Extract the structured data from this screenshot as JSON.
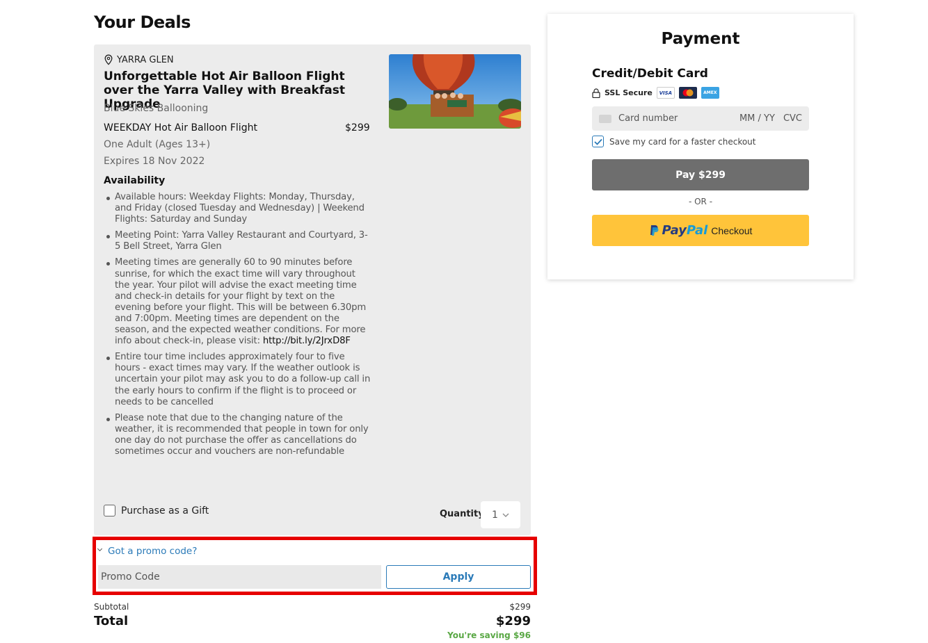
{
  "page": {
    "heading": "Your Deals"
  },
  "deal": {
    "location": "YARRA GLEN",
    "title": "Unforgettable Hot Air Balloon Flight over the Yarra Valley with Breakfast Upgrade",
    "operator": "Blue Skies Ballooning",
    "option_name": "WEEKDAY Hot Air Balloon Flight",
    "option_price": "$299",
    "pax": "One Adult (Ages 13+)",
    "expires": "Expires 18 Nov 2022",
    "availability_title": "Availability",
    "availability": [
      "Available hours: Weekday Flights: Monday, Thursday, and Friday (closed Tuesday and Wednesday) | Weekend Flights: Saturday and Sunday",
      "Meeting Point: Yarra Valley Restaurant and Courtyard, 3-5 Bell Street, Yarra Glen",
      "Meeting times are generally 60 to 90 minutes before sunrise, for which the exact time will vary throughout the year. Your pilot will advise the exact meeting time and check-in details for your flight by text on the evening before your flight. This will be between 6.30pm and 7:00pm. Meeting times are dependent on the season, and the expected weather conditions. For more info about check-in, please visit:",
      "Entire tour time includes approximately four to five hours - exact times may vary. If the weather outlook is uncertain your pilot may ask you to do a follow-up call in the early hours to confirm if the flight is to proceed or needs to be cancelled",
      "Please note that due to the changing nature of the weather, it is recommended that people in town for only one day do not purchase the offer as cancellations do sometimes occur and vouchers are non-refundable"
    ],
    "checkin_link": "http://bit.ly/2JrxD8F",
    "gift_label": "Purchase as a Gift",
    "quantity_label": "Quantity",
    "quantity_value": "1"
  },
  "promo": {
    "link_label": "Got a promo code?",
    "placeholder": "Promo Code",
    "apply_label": "Apply"
  },
  "totals": {
    "subtotal_label": "Subtotal",
    "subtotal_value": "$299",
    "total_label": "Total",
    "total_value": "$299",
    "saving": "You're saving $96"
  },
  "payment": {
    "title": "Payment",
    "method_title": "Credit/Debit Card",
    "ssl_label": "SSL Secure",
    "card_logos": [
      "VISA",
      "mastercard",
      "AMEX"
    ],
    "card_number_placeholder": "Card number",
    "expiry_placeholder": "MM / YY",
    "cvc_placeholder": "CVC",
    "save_card_label": "Save my card for a faster checkout",
    "save_card_checked": true,
    "pay_button": "Pay $299",
    "or_label": "- OR -",
    "paypal_pay": "Pay",
    "paypal_pal": "Pal",
    "paypal_checkout": "Checkout"
  },
  "colors": {
    "highlight": "#e60000",
    "link": "#2a7ab8",
    "pay_button": "#6e6e6e",
    "paypal": "#ffc43a",
    "saving": "#5aa845"
  }
}
